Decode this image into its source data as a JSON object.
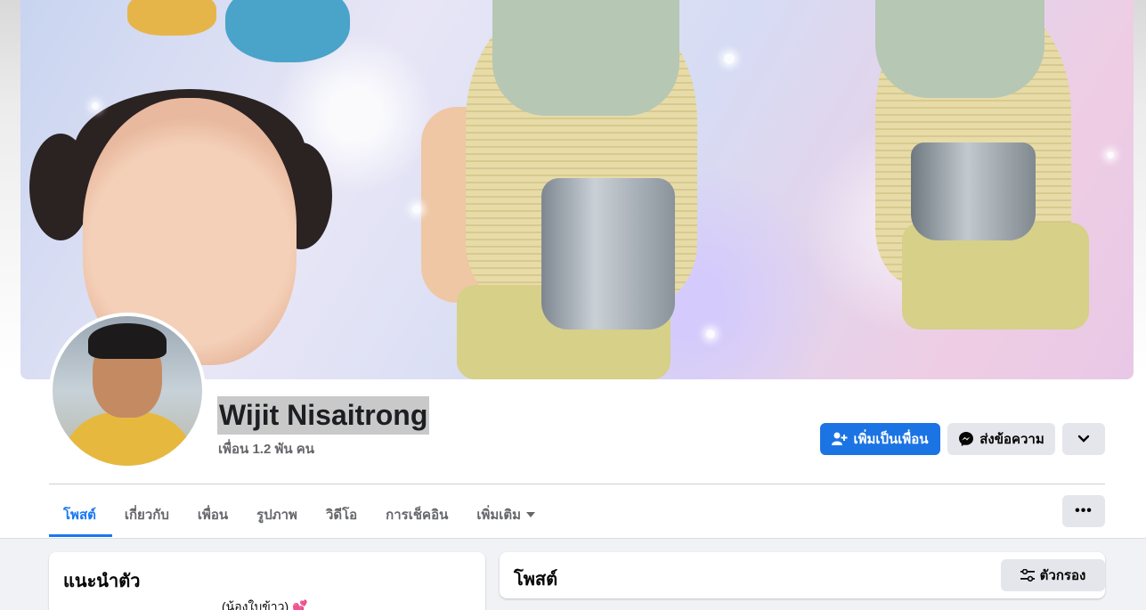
{
  "profile": {
    "name": "Wijit Nisaitrong",
    "friends_count": "เพื่อน 1.2 พัน คน"
  },
  "actions": {
    "add_friend": "เพิ่มเป็นเพื่อน",
    "message": "ส่งข้อความ",
    "more_icon": "chevron-down-icon"
  },
  "tabs": [
    {
      "label": "โพสต์",
      "active": true
    },
    {
      "label": "เกี่ยวกับ"
    },
    {
      "label": "เพื่อน"
    },
    {
      "label": "รูปภาพ"
    },
    {
      "label": "วิดีโอ"
    },
    {
      "label": "การเช็คอิน"
    },
    {
      "label": "เพิ่มเติม"
    }
  ],
  "tab_overflow": "•••",
  "intro": {
    "title": "แนะนำตัว",
    "bio": "(น้องใบข้าว) 💕"
  },
  "posts": {
    "title": "โพสต์",
    "filter_label": "ตัวกรอง"
  },
  "colors": {
    "primary": "#1b74e4",
    "active_tab": "#1877f2",
    "secondary_bg": "#e4e6eb",
    "page_bg": "#f0f2f5"
  }
}
